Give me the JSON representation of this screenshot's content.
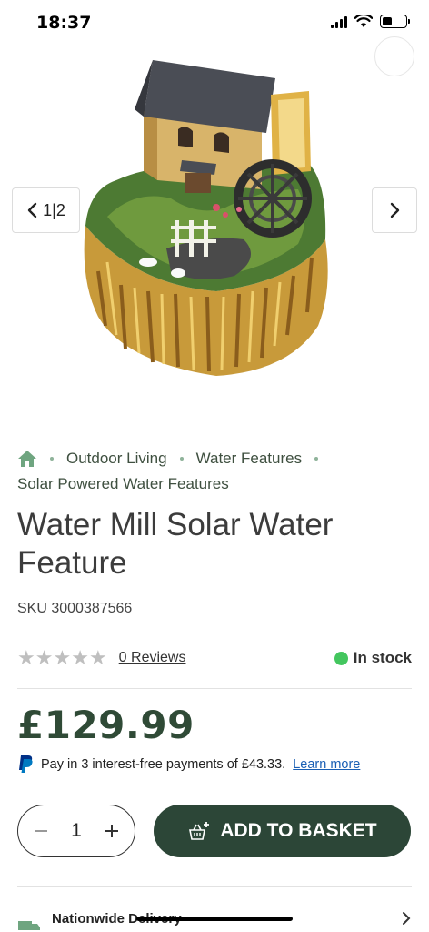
{
  "status_bar": {
    "time": "18:37",
    "battery_level": 0.4
  },
  "gallery": {
    "counter": "1|2"
  },
  "breadcrumb": {
    "items": [
      "Outdoor Living",
      "Water Features",
      "Solar Powered Water Features"
    ]
  },
  "product": {
    "title": "Water Mill Solar Water Feature",
    "sku": "SKU 3000387566",
    "rating": 0,
    "rating_max": 5,
    "reviews_label": "0 Reviews",
    "stock_label": "In stock",
    "price": "£129.99"
  },
  "paypal": {
    "text": "Pay in 3 interest-free payments of £43.33.",
    "link": "Learn more"
  },
  "quantity": {
    "value": "1"
  },
  "cart": {
    "add_label": "ADD TO BASKET"
  },
  "delivery": {
    "title": "Nationwide Delivery"
  },
  "colors": {
    "accent": "#2c4637",
    "price": "#2f4a36",
    "stock": "#43c65e",
    "link": "#1a5fb4",
    "breadcrumb_home": "#6fa580"
  }
}
